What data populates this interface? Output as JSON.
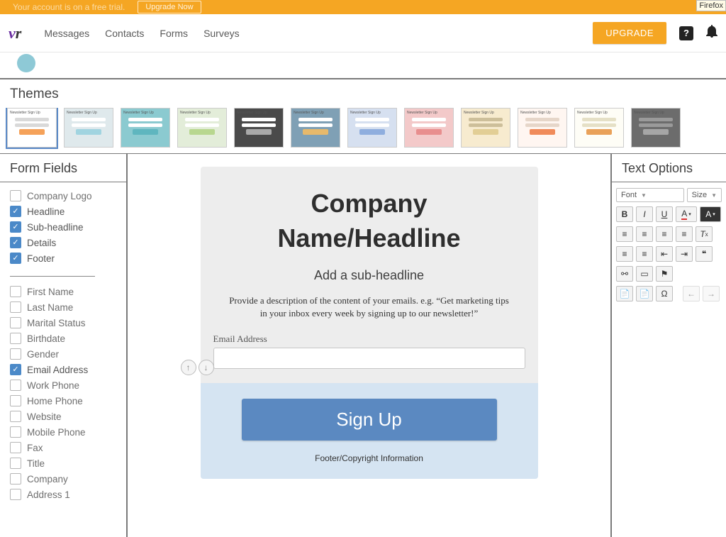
{
  "trial": {
    "text": "Your account is on a free trial.",
    "cta": "Upgrade Now"
  },
  "browser_tag": "Firefox",
  "nav": {
    "links": {
      "messages": "Messages",
      "contacts": "Contacts",
      "forms": "Forms",
      "surveys": "Surveys"
    },
    "upgrade": "UPGRADE"
  },
  "themes": {
    "header": "Themes",
    "thumb_title": "Newsletter Sign Up",
    "items": [
      {
        "bg": "#ffffff",
        "line": "#d9d9d9",
        "btn": "#f5a25a",
        "selected": true
      },
      {
        "bg": "#dfe9ec",
        "line": "#ffffff",
        "btn": "#a1d4e0",
        "selected": false
      },
      {
        "bg": "#8bcad0",
        "line": "#ffffff",
        "btn": "#5fb6bf",
        "selected": false
      },
      {
        "bg": "#e3edd9",
        "line": "#ffffff",
        "btn": "#b8d78f",
        "selected": false
      },
      {
        "bg": "#4a4a4a",
        "line": "#ffffff",
        "btn": "#a9a9a9",
        "selected": false
      },
      {
        "bg": "#7fa0b5",
        "line": "#ffffff",
        "btn": "#e7b96b",
        "selected": false
      },
      {
        "bg": "#d6e0f0",
        "line": "#ffffff",
        "btn": "#8faede",
        "selected": false
      },
      {
        "bg": "#f3c9c9",
        "line": "#ffffff",
        "btn": "#e88e8e",
        "selected": false
      },
      {
        "bg": "#f7ebcf",
        "line": "#cdbf9a",
        "btn": "#e2ce95",
        "selected": false
      },
      {
        "bg": "#fff6f1",
        "line": "#e6d6c9",
        "btn": "#f08b5a",
        "selected": false
      },
      {
        "bg": "#fefdf6",
        "line": "#e5e0c6",
        "btn": "#e9a159",
        "selected": false
      },
      {
        "bg": "#6c6c6c",
        "line": "#9a9a9a",
        "btn": "#a6a6a6",
        "selected": false
      }
    ]
  },
  "form_fields": {
    "header": "Form Fields",
    "group1": [
      {
        "label": "Company Logo",
        "checked": false
      },
      {
        "label": "Headline",
        "checked": true
      },
      {
        "label": "Sub-headline",
        "checked": true
      },
      {
        "label": "Details",
        "checked": true
      },
      {
        "label": "Footer",
        "checked": true
      }
    ],
    "group2": [
      {
        "label": "First Name",
        "checked": false
      },
      {
        "label": "Last Name",
        "checked": false
      },
      {
        "label": "Marital Status",
        "checked": false
      },
      {
        "label": "Birthdate",
        "checked": false
      },
      {
        "label": "Gender",
        "checked": false
      },
      {
        "label": "Email Address",
        "checked": true
      },
      {
        "label": "Work Phone",
        "checked": false
      },
      {
        "label": "Home Phone",
        "checked": false
      },
      {
        "label": "Website",
        "checked": false
      },
      {
        "label": "Mobile Phone",
        "checked": false
      },
      {
        "label": "Fax",
        "checked": false
      },
      {
        "label": "Title",
        "checked": false
      },
      {
        "label": "Company",
        "checked": false
      },
      {
        "label": "Address 1",
        "checked": false
      }
    ]
  },
  "preview": {
    "headline": "Company Name/Headline",
    "subheadline": "Add a sub-headline",
    "details": "Provide a description of the content of your emails. e.g. “Get marketing tips in your inbox every week by signing up to our newsletter!”",
    "email_label": "Email Address",
    "cta": "Sign Up",
    "footer": "Footer/Copyright Information"
  },
  "text_options": {
    "header": "Text Options",
    "font_label": "Font",
    "size_label": "Size"
  }
}
